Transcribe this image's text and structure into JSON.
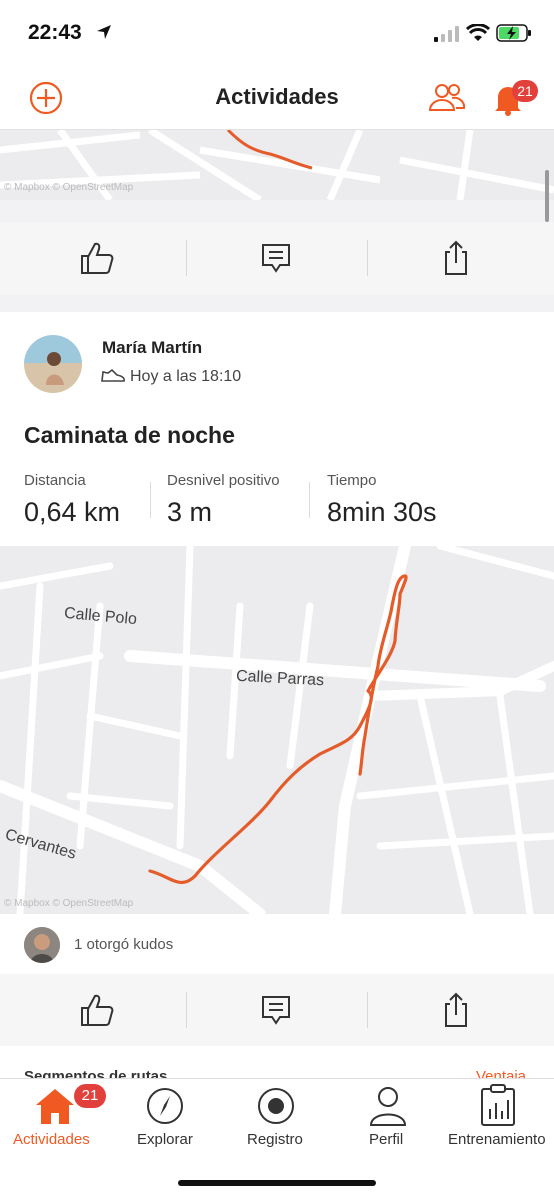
{
  "status_bar": {
    "time": "22:43",
    "battery_icon": "battery-charging-icon"
  },
  "nav": {
    "title": "Actividades",
    "notification_count": "21"
  },
  "activity": {
    "athlete": "María Martín",
    "time_label": "Hoy a las 18:10",
    "title": "Caminata de noche",
    "stats": [
      {
        "label": "Distancia",
        "value": "0,64 km"
      },
      {
        "label": "Desnivel positivo",
        "value": "3 m"
      },
      {
        "label": "Tiempo",
        "value": "8min 30s"
      }
    ],
    "map_streets": [
      "Calle Polo",
      "Calle Parras",
      "Cervantes"
    ],
    "map_credit": "© Mapbox © OpenStreetMap",
    "kudos_text": "1 otorgó kudos"
  },
  "next_card": {
    "left": "Segmentos de rutas",
    "right": "Ventaja"
  },
  "tabs": [
    {
      "label": "Actividades",
      "icon": "home-icon",
      "badge": "21"
    },
    {
      "label": "Explorar",
      "icon": "compass-icon"
    },
    {
      "label": "Registro",
      "icon": "record-icon"
    },
    {
      "label": "Perfil",
      "icon": "person-icon"
    },
    {
      "label": "Entrenamiento",
      "icon": "clipboard-chart-icon"
    }
  ],
  "colors": {
    "accent": "#f05a22",
    "badge": "#e2403a",
    "route": "#e55c2b"
  }
}
